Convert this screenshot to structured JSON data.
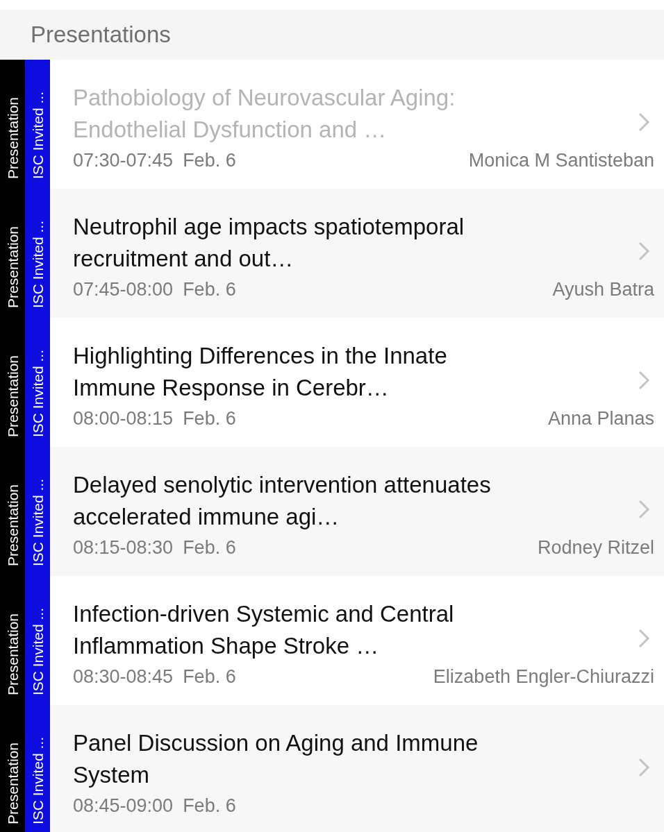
{
  "header": {
    "title": "Presentations"
  },
  "items": [
    {
      "type_label": "Presentation",
      "track_label": "ISC Invited ...",
      "title": "Pathobiology of Neurovascular Aging: Endothelial Dysfunction and …",
      "time": "07:30-07:45",
      "date": "Feb. 6",
      "speaker": "Monica M Santisteban",
      "past": true
    },
    {
      "type_label": "Presentation",
      "track_label": "ISC Invited ...",
      "title": "Neutrophil age impacts spatiotemporal recruitment and out…",
      "time": "07:45-08:00",
      "date": "Feb. 6",
      "speaker": "Ayush Batra",
      "past": false
    },
    {
      "type_label": "Presentation",
      "track_label": "ISC Invited ...",
      "title": "Highlighting Differences in the Innate Immune Response in Cerebr…",
      "time": "08:00-08:15",
      "date": "Feb. 6",
      "speaker": "Anna Planas",
      "past": false
    },
    {
      "type_label": "Presentation",
      "track_label": "ISC Invited ...",
      "title": "Delayed senolytic intervention attenuates accelerated immune agi…",
      "time": "08:15-08:30",
      "date": "Feb. 6",
      "speaker": "Rodney Ritzel",
      "past": false
    },
    {
      "type_label": "Presentation",
      "track_label": "ISC Invited ...",
      "title": "Infection-driven Systemic and Central Inflammation Shape Stroke …",
      "time": "08:30-08:45",
      "date": "Feb. 6",
      "speaker": "Elizabeth Engler-Chiurazzi",
      "past": false
    },
    {
      "type_label": "Presentation",
      "track_label": "ISC Invited ...",
      "title": "Panel Discussion on Aging and Immune System",
      "time": "08:45-09:00",
      "date": "Feb. 6",
      "past": false
    }
  ]
}
